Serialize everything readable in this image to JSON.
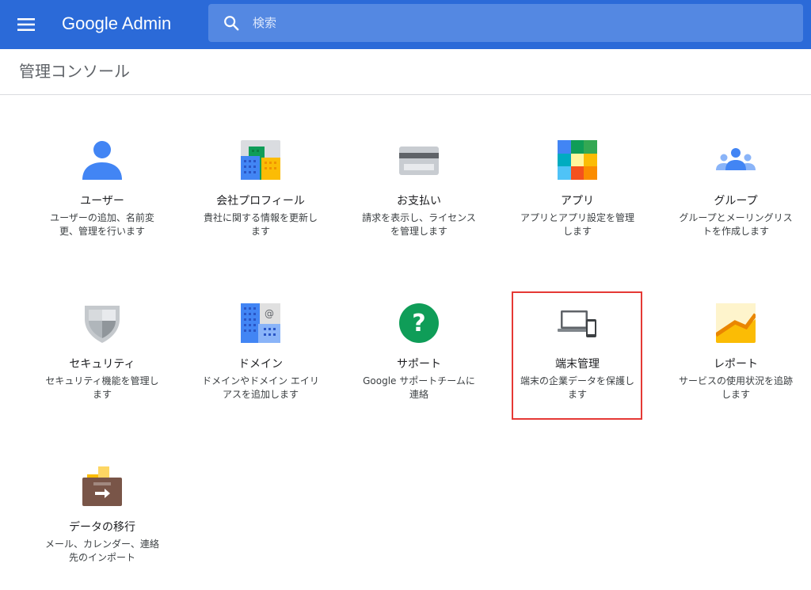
{
  "header": {
    "brand": "Google Admin",
    "search_placeholder": "検索",
    "color": "#2b6ad8"
  },
  "page": {
    "title": "管理コンソール"
  },
  "cards": [
    {
      "title": "ユーザー",
      "desc": "ユーザーの追加、名前変更、管理を行います",
      "icon": "user-icon"
    },
    {
      "title": "会社プロフィール",
      "desc": "貴社に関する情報を更新します",
      "icon": "company-building-icon"
    },
    {
      "title": "お支払い",
      "desc": "請求を表示し、ライセンスを管理します",
      "icon": "credit-card-icon"
    },
    {
      "title": "アプリ",
      "desc": "アプリとアプリ設定を管理します",
      "icon": "apps-grid-icon"
    },
    {
      "title": "グループ",
      "desc": "グループとメーリングリストを作成します",
      "icon": "groups-icon"
    },
    {
      "title": "セキュリティ",
      "desc": "セキュリティ機能を管理します",
      "icon": "shield-icon"
    },
    {
      "title": "ドメイン",
      "desc": "ドメインやドメイン エイリアスを追加します",
      "icon": "domain-building-icon"
    },
    {
      "title": "サポート",
      "desc": "Google サポートチームに連絡",
      "icon": "help-question-icon"
    },
    {
      "title": "端末管理",
      "desc": "端末の企業データを保護します",
      "icon": "devices-icon"
    },
    {
      "title": "レポート",
      "desc": "サービスの使用状況を追跡します",
      "icon": "report-chart-icon"
    },
    {
      "title": "データの移行",
      "desc": "メール、カレンダー、連絡先のインポート",
      "icon": "data-migration-icon"
    }
  ],
  "highlight": {
    "card": "端末管理",
    "color": "#e53935"
  }
}
